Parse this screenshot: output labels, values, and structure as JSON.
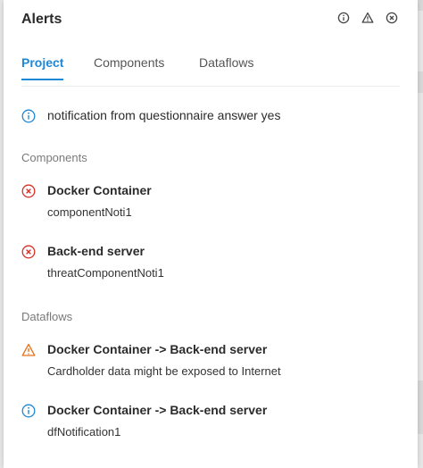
{
  "header": {
    "title": "Alerts",
    "icons": [
      "info-icon",
      "warning-icon",
      "close-icon"
    ]
  },
  "tabs": [
    {
      "label": "Project",
      "active": true
    },
    {
      "label": "Components",
      "active": false
    },
    {
      "label": "Dataflows",
      "active": false
    }
  ],
  "project": {
    "notification": {
      "icon": "info-icon",
      "text": "notification from questionnaire answer yes"
    }
  },
  "components": {
    "label": "Components",
    "items": [
      {
        "icon": "error-icon",
        "title": "Docker Container",
        "detail": "componentNoti1"
      },
      {
        "icon": "error-icon",
        "title": "Back-end server",
        "detail": "threatComponentNoti1"
      }
    ]
  },
  "dataflows": {
    "label": "Dataflows",
    "items": [
      {
        "icon": "warning-icon",
        "title": "Docker Container -> Back-end server",
        "detail": "Cardholder data might be exposed to Internet"
      },
      {
        "icon": "info-icon",
        "title": "Docker Container -> Back-end server",
        "detail": "dfNotification1"
      }
    ]
  },
  "colors": {
    "accent": "#1e88d6",
    "error": "#d93025",
    "warning": "#e8711a",
    "info": "#1e88d6"
  }
}
